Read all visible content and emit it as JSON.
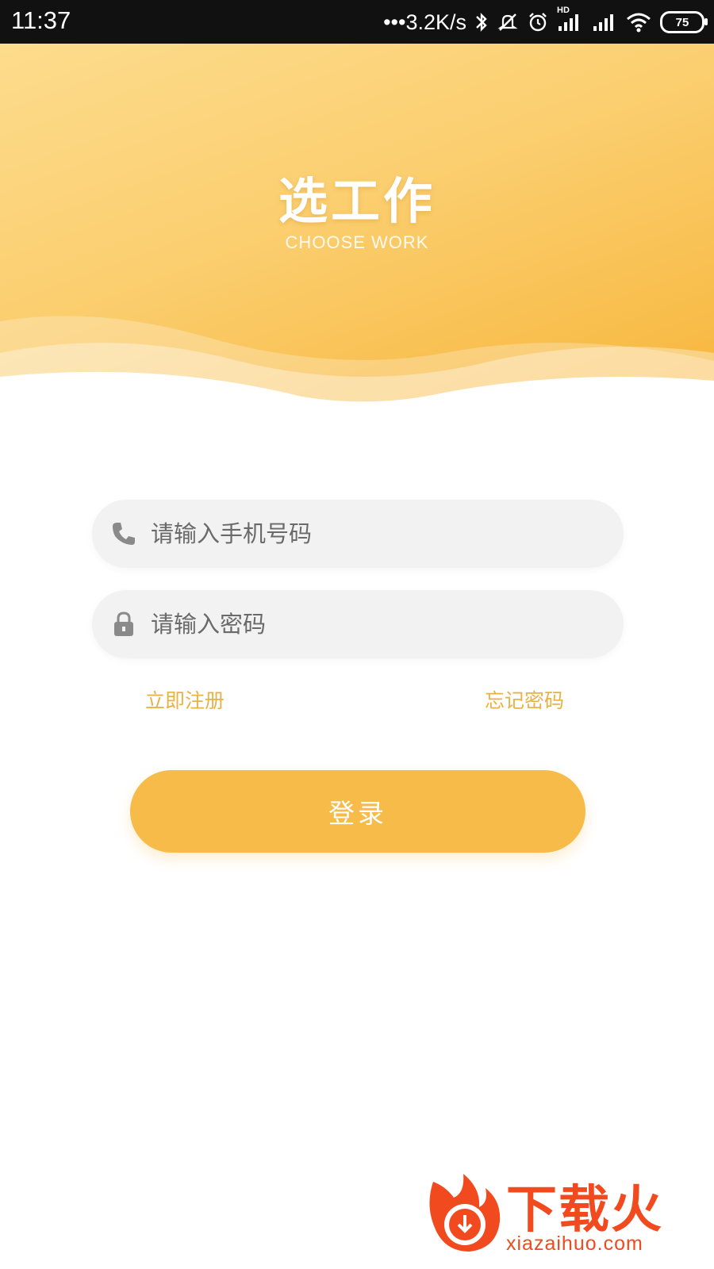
{
  "status_bar": {
    "time": "11:37",
    "net_speed": "•••3.2K/s",
    "battery": "75",
    "hd_badge": "HD"
  },
  "header": {
    "title": "选工作",
    "subtitle": "CHOOSE WORK",
    "gradient_colors": [
      "#fddc8d",
      "#f7b53a"
    ]
  },
  "form": {
    "phone": {
      "placeholder": "请输入手机号码",
      "value": "",
      "icon": "phone-icon"
    },
    "password": {
      "placeholder": "请输入密码",
      "value": "",
      "icon": "lock-icon"
    },
    "register_link": "立即注册",
    "forgot_link": "忘记密码",
    "login_button": "登录"
  },
  "watermark": {
    "brand": "下载火",
    "url": "xiazaihuo.com"
  },
  "colors": {
    "accent": "#f7bb49",
    "link": "#e9b245",
    "field_bg": "#f2f2f2",
    "status_bar": "#111111",
    "watermark": "#f04a1e"
  }
}
